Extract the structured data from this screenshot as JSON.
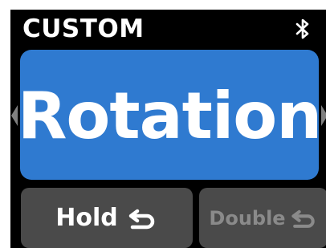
{
  "header": {
    "title": "CUSTOM",
    "status_icon": "bluetooth-icon"
  },
  "nav": {
    "left_icon": "chevron-left-icon",
    "right_icon": "chevron-right-icon"
  },
  "main": {
    "label": "Rotation",
    "color": "#2f7ad0"
  },
  "actions": [
    {
      "label": "Hold",
      "icon": "return-arrow-icon",
      "active": true
    },
    {
      "label": "Double",
      "icon": "return-arrow-icon",
      "active": false
    }
  ],
  "colors": {
    "background": "#000000",
    "button": "#4a4a4a",
    "text_active": "#ffffff",
    "text_inactive": "#8a8a8a",
    "arrow": "#808080"
  }
}
